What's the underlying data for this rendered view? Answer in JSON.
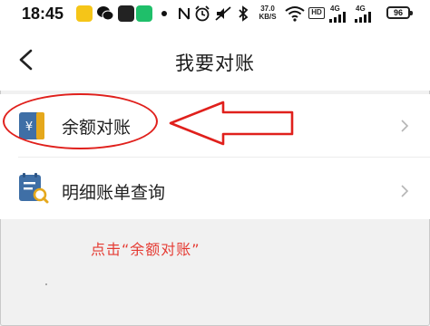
{
  "status_bar": {
    "time": "18:45",
    "net_speed": "37.0\nKB/S",
    "hd_label": "HD",
    "sim1_label": "4G",
    "sim2_label": "4G",
    "battery": "96",
    "icons": [
      "notification-app-icon",
      "wechat-icon",
      "notification-app-icon",
      "dot-icon",
      "nfc-icon",
      "alarm-icon",
      "mute-icon",
      "bluetooth-icon",
      "wifi-icon",
      "signal-icon",
      "signal-icon",
      "battery-icon"
    ]
  },
  "nav": {
    "title": "我要对账",
    "back_icon": "chevron-left-icon"
  },
  "list": {
    "items": [
      {
        "label": "余额对账",
        "icon": "yen-document-icon"
      },
      {
        "label": "明细账单查询",
        "icon": "bill-search-icon"
      }
    ]
  },
  "annotation": {
    "hint_text": "点击“余额对账”",
    "accent_color": "#e0201c"
  },
  "colors": {
    "background": "#f1f1f1",
    "card": "#ffffff",
    "icon_blue": "#3f6fa6",
    "icon_gold": "#e5a81c"
  }
}
